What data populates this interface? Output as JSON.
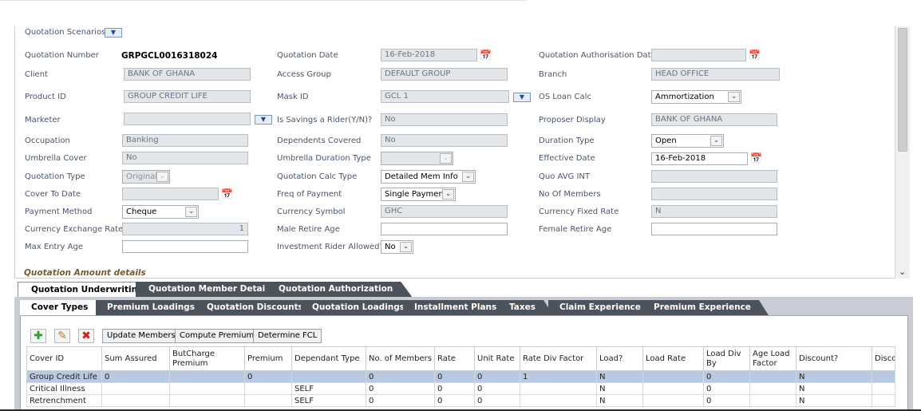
{
  "form": {
    "quotation_scenarios": "Quotation Scenarios",
    "quotation_number_label": "Quotation Number",
    "quotation_number": "GRPGCL0016318024",
    "quotation_date_label": "Quotation Date",
    "quotation_date": "16-Feb-2018",
    "auth_date_label": "Quotation Authorisation Date",
    "auth_date": "",
    "client_label": "Client",
    "client": "BANK OF GHANA",
    "access_group_label": "Access Group",
    "access_group": "DEFAULT GROUP",
    "branch_label": "Branch",
    "branch": "HEAD OFFICE",
    "product_id_label": "Product ID",
    "product_id": "GROUP CREDIT LIFE",
    "mask_id_label": "Mask ID",
    "mask_id": "GCL 1",
    "os_loan_calc_label": "OS Loan Calc",
    "os_loan_calc": "Ammortization",
    "marketer_label": "Marketer",
    "marketer": "",
    "savings_rider_label": "Is Savings a Rider(Y/N)?",
    "savings_rider": "No",
    "proposer_display_label": "Proposer Display",
    "proposer_display": "BANK OF GHANA",
    "occupation_label": "Occupation",
    "occupation": "Banking",
    "dependents_covered_label": "Dependents Covered",
    "dependents_covered": "No",
    "duration_type_label": "Duration Type",
    "duration_type": "Open",
    "umbrella_cover_label": "Umbrella Cover",
    "umbrella_cover": "No",
    "umbrella_duration_label": "Umbrella Duration Type",
    "umbrella_duration": "",
    "effective_date_label": "Effective Date",
    "effective_date": "16-Feb-2018",
    "quotation_type_label": "Quotation Type",
    "quotation_type": "Original",
    "calc_type_label": "Quotation Calc Type",
    "calc_type": "Detailed Mem Info",
    "quo_avg_int_label": "Quo AVG INT",
    "quo_avg_int": "",
    "cover_to_date_label": "Cover To Date",
    "cover_to_date": "",
    "freq_payment_label": "Freq of Payment",
    "freq_payment": "Single Payment",
    "no_members_label": "No Of Members",
    "no_members": "",
    "payment_method_label": "Payment Method",
    "payment_method": "Cheque",
    "currency_symbol_label": "Currency Symbol",
    "currency_symbol": "GHC",
    "currency_fixed_rate_label": "Currency Fixed Rate",
    "currency_fixed_rate": "N",
    "exchange_rate_label": "Currency Exchange Rate",
    "exchange_rate": "1",
    "male_retire_label": "Male Retire Age",
    "male_retire": "",
    "female_retire_label": "Female Retire Age",
    "female_retire": "",
    "max_entry_label": "Max Entry Age",
    "max_entry": "",
    "investment_rider_label": "Investment Rider Allowed?",
    "investment_rider": "No",
    "amount_details": "Quotation Amount details"
  },
  "tabs": [
    "Quotation Underwriting",
    "Quotation Member Details",
    "Quotation Authorization"
  ],
  "subtabs": [
    "Cover Types",
    "Premium Loadings",
    "Quotation Discounts",
    "Quotation Loadings",
    "Installment Plans",
    "Taxes",
    "Claim Experience",
    "Premium Experience"
  ],
  "toolbar": {
    "update_members": "Update Members",
    "compute_premium": "Compute Premium",
    "determine_fcl": "Determine FCL"
  },
  "grid": {
    "headers": [
      "Cover ID",
      "Sum Assured",
      "ButCharge Premium",
      "Premium",
      "Dependant Type",
      "No. of Members",
      "Rate",
      "Unit Rate",
      "Rate Div Factor",
      "Load?",
      "Load Rate",
      "Load Div By",
      "Age Load Factor",
      "Discount?",
      "Discou"
    ],
    "rows": [
      [
        "Group Credit Life",
        "0",
        "",
        "0",
        "",
        "0",
        "0",
        "0",
        "1",
        "N",
        "",
        "0",
        "",
        "N",
        ""
      ],
      [
        "Critical Illness",
        "",
        "",
        "",
        "SELF",
        "0",
        "0",
        "0",
        "",
        "N",
        "",
        "0",
        "",
        "N",
        ""
      ],
      [
        "Retrenchment",
        "",
        "",
        "",
        "SELF",
        "0",
        "0",
        "0",
        "",
        "N",
        "",
        "0",
        "",
        "N",
        ""
      ]
    ]
  },
  "colors": {
    "tab_dark": "#4d535b",
    "selected_row": "#b9c9e1",
    "readonly_field": "#e4e7ea",
    "section_header": "#7a5a2f"
  }
}
